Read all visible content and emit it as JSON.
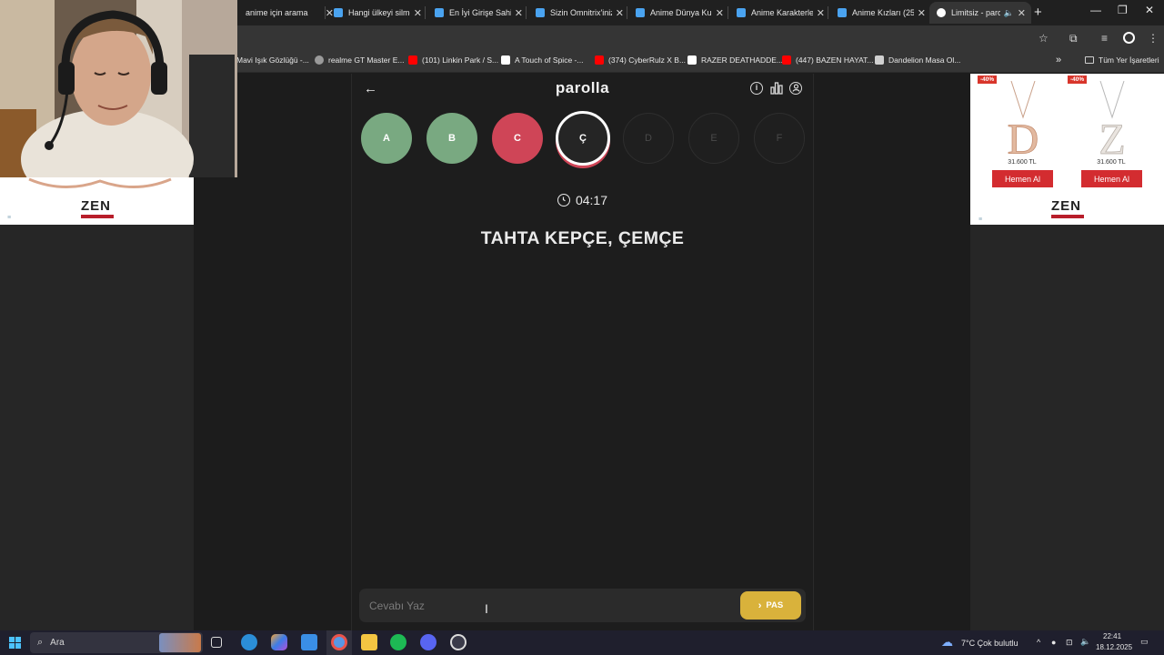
{
  "browser": {
    "tabs": [
      {
        "title": "anime için arama",
        "fav_color": "#4285f4"
      },
      {
        "title": "Hangi ülkeyi silmek",
        "fav_color": "#4aa3f0"
      },
      {
        "title": "En İyi Girişe Sahip",
        "fav_color": "#4aa3f0"
      },
      {
        "title": "Sizin Omnitrix'iniz",
        "fav_color": "#4aa3f0"
      },
      {
        "title": "Anime Dünya Kupası",
        "fav_color": "#4aa3f0"
      },
      {
        "title": "Anime Karakterleri",
        "fav_color": "#4aa3f0"
      },
      {
        "title": "Anime Kızları (25",
        "fav_color": "#4aa3f0"
      },
      {
        "title": "Limitsiz - paro",
        "fav_color": "#ffffff",
        "active": true
      }
    ],
    "bookmarks": [
      {
        "label": "Mavi Işık Gözlüğü -...",
        "fav_color": "#4a4a4a"
      },
      {
        "label": "realme GT Master E...",
        "fav_color": "#9a9a9a"
      },
      {
        "label": "(101) Linkin Park / S...",
        "fav_color": "#ff0000"
      },
      {
        "label": "A Touch of Spice -...",
        "fav_color": "#ffffff"
      },
      {
        "label": "(374) CyberRulz X B...",
        "fav_color": "#ff0000"
      },
      {
        "label": "RAZER DEATHADDE...",
        "fav_color": "#ffffff"
      },
      {
        "label": "(447) BAZEN HAYAT...",
        "fav_color": "#ff0000"
      },
      {
        "label": "Dandelion Masa Ol...",
        "fav_color": "#d0d0d0"
      }
    ],
    "all_bookmarks_label": "Tüm Yer İşaretleri"
  },
  "game": {
    "brand": "parolla",
    "letters": [
      {
        "char": "A",
        "state": "correct"
      },
      {
        "char": "B",
        "state": "correct"
      },
      {
        "char": "C",
        "state": "wrong"
      },
      {
        "char": "Ç",
        "state": "current"
      },
      {
        "char": "D",
        "state": "pending"
      },
      {
        "char": "E",
        "state": "pending"
      },
      {
        "char": "F",
        "state": "pending"
      }
    ],
    "timer": "04:17",
    "question": "TAHTA KEPÇE, ÇEMÇE",
    "answer_placeholder": "Cevabı Yaz",
    "pass_label": "PAS",
    "colors": {
      "correct": "#79a981",
      "wrong": "#cf4557",
      "pass": "#d9b23b"
    }
  },
  "ads": {
    "right": {
      "items": [
        {
          "discount": "-40%",
          "price": "31.600 TL",
          "button": "Hemen Al",
          "letter": "D"
        },
        {
          "discount": "-40%",
          "price": "31.600 TL",
          "button": "Hemen Al",
          "letter": "Z"
        }
      ],
      "logo": "ZEN"
    },
    "left": {
      "logo": "ZEN"
    }
  },
  "taskbar": {
    "search_label": "Ara",
    "weather": "7°C  Çok bulutlu",
    "time": "22:41",
    "date": "18.12.2025"
  }
}
